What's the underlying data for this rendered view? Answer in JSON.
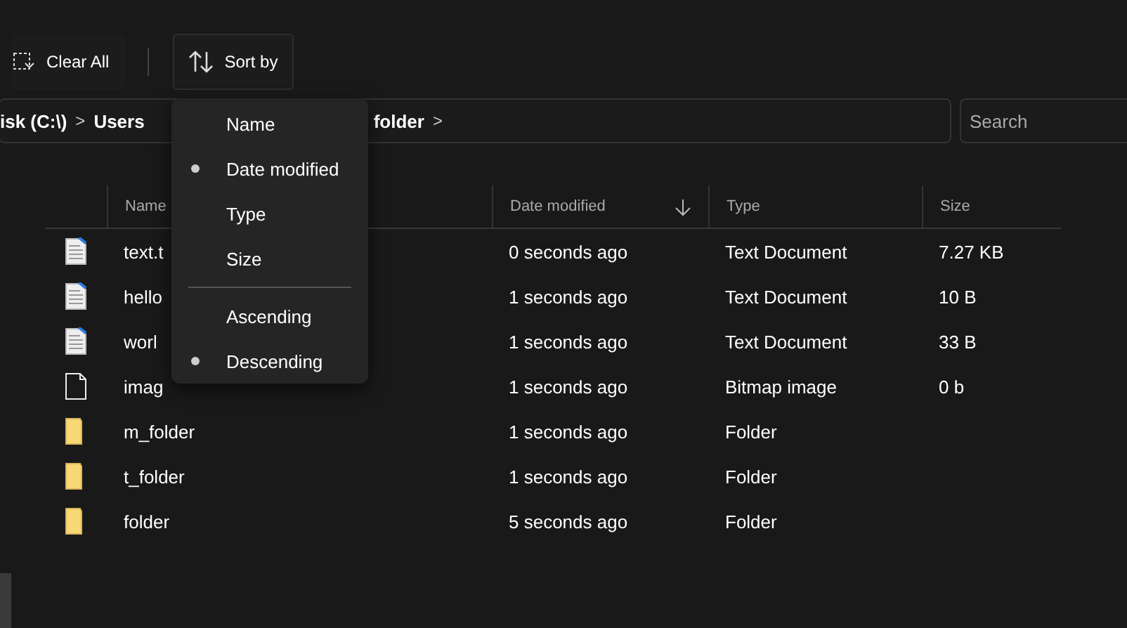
{
  "toolbar": {
    "clear_all": "Clear All",
    "sort_by": "Sort by"
  },
  "breadcrumb": [
    {
      "label": "isk (C:\\)"
    },
    {
      "label": "Users"
    },
    {
      "label": "folder"
    }
  ],
  "breadcrumb_separator": ">",
  "search": {
    "placeholder": "Search"
  },
  "table": {
    "columns": [
      {
        "label": "Name",
        "sorted": false
      },
      {
        "label": "Date modified",
        "sorted": true
      },
      {
        "label": "Type",
        "sorted": false
      },
      {
        "label": "Size",
        "sorted": false
      }
    ],
    "rows": [
      {
        "kind": "text",
        "name": "text.t",
        "date": "0 seconds ago",
        "type": "Text Document",
        "size": "7.27 KB"
      },
      {
        "kind": "text",
        "name": "hello",
        "date": "1 seconds ago",
        "type": "Text Document",
        "size": "10 B"
      },
      {
        "kind": "text",
        "name": "worl",
        "date": "1 seconds ago",
        "type": "Text Document",
        "size": "33 B"
      },
      {
        "kind": "blank",
        "name": "imag",
        "date": "1 seconds ago",
        "type": "Bitmap image",
        "size": "0 b"
      },
      {
        "kind": "folder",
        "name": "m_folder",
        "date": "1 seconds ago",
        "type": "Folder",
        "size": ""
      },
      {
        "kind": "folder",
        "name": "t_folder",
        "date": "1 seconds ago",
        "type": "Folder",
        "size": ""
      },
      {
        "kind": "folder",
        "name": "folder",
        "date": "5 seconds ago",
        "type": "Folder",
        "size": ""
      }
    ]
  },
  "sort_menu": {
    "fields": [
      {
        "label": "Name",
        "selected": false
      },
      {
        "label": "Date modified",
        "selected": true
      },
      {
        "label": "Type",
        "selected": false
      },
      {
        "label": "Size",
        "selected": false
      }
    ],
    "orders": [
      {
        "label": "Ascending",
        "selected": false
      },
      {
        "label": "Descending",
        "selected": true
      }
    ]
  }
}
